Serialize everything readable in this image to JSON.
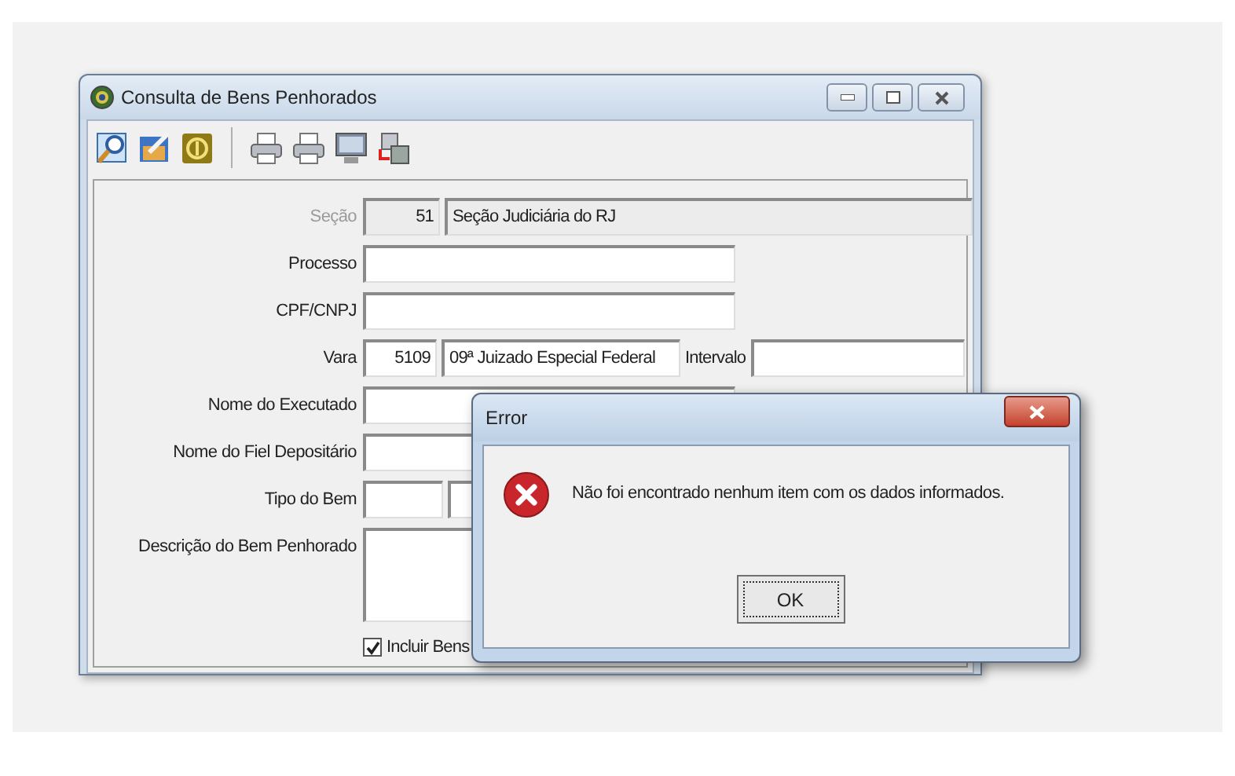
{
  "window": {
    "title": "Consulta de Bens Penhorados"
  },
  "toolbar": [
    {
      "kind": "search"
    },
    {
      "kind": "edit"
    },
    {
      "kind": "ring"
    },
    {
      "kind": "separator"
    },
    {
      "kind": "printer"
    },
    {
      "kind": "printer"
    },
    {
      "kind": "monitor"
    },
    {
      "kind": "export"
    }
  ],
  "form": [
    {
      "label": "Seção",
      "disabled": true,
      "kind": "code_name",
      "code": "51",
      "name": "Seção Judiciária do RJ"
    },
    {
      "label": "Processo",
      "disabled": false,
      "kind": "text"
    },
    {
      "label": "CPF/CNPJ",
      "disabled": false,
      "kind": "text"
    },
    {
      "label": "Vara",
      "disabled": false,
      "kind": "vara",
      "code": "5109",
      "name": "09ª Juizado Especial Federal",
      "extra_label": "Intervalo"
    },
    {
      "label": "Nome do Executado",
      "disabled": false,
      "kind": "text"
    },
    {
      "label": "Nome do Fiel Depositário",
      "disabled": false,
      "kind": "text"
    },
    {
      "label": "Tipo do Bem",
      "disabled": false,
      "kind": "pair"
    },
    {
      "label": "Descrição do Bem Penhorado",
      "disabled": false,
      "kind": "textarea"
    }
  ],
  "include_checkbox": {
    "label": "Incluir Bens",
    "checked": true
  },
  "dialog": {
    "title": "Error",
    "message": "Não foi encontrado nenhum item com os dados informados.",
    "button": "OK"
  }
}
